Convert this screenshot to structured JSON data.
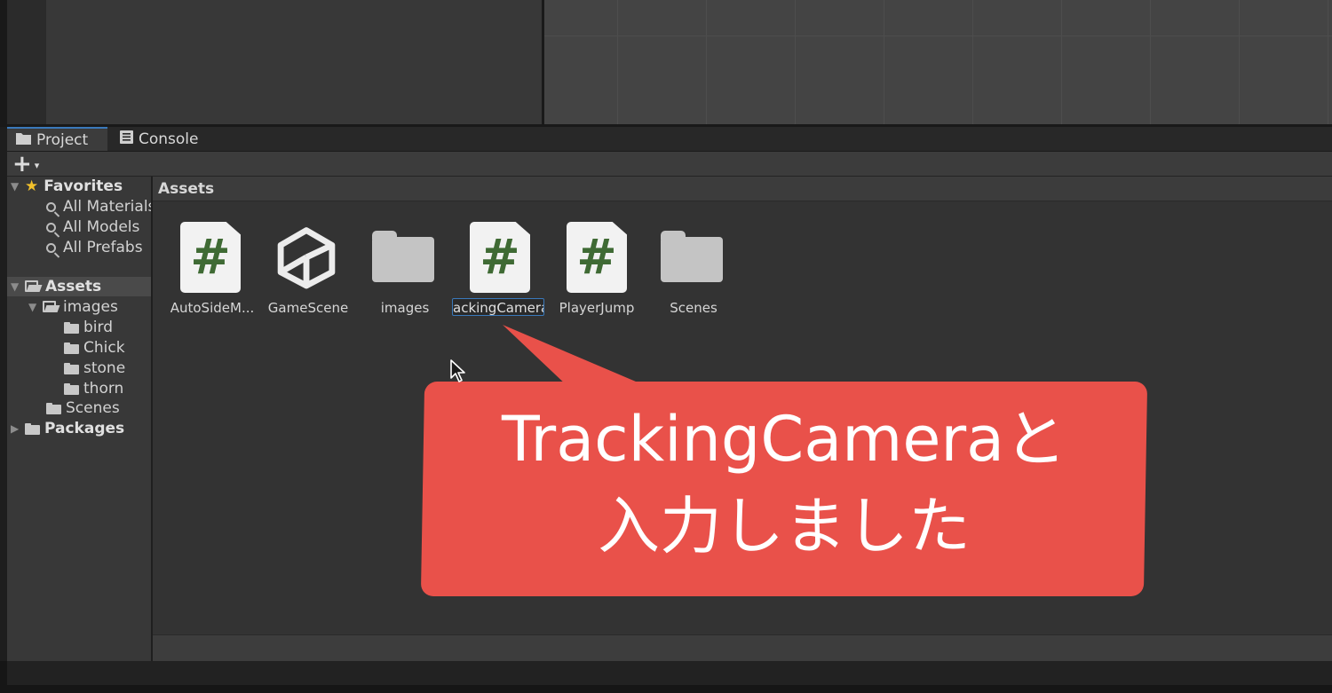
{
  "tabs": [
    {
      "label": "Project",
      "icon": "folder-icon"
    },
    {
      "label": "Console",
      "icon": "console-icon"
    }
  ],
  "toolbar": {
    "add_label": "+",
    "add_caret": "▾"
  },
  "sidebar": {
    "favorites": {
      "label": "Favorites",
      "items": [
        "All Materials",
        "All Models",
        "All Prefabs"
      ]
    },
    "assets": {
      "label": "Assets",
      "images": {
        "label": "images",
        "children": [
          "bird",
          "Chick",
          "stone",
          "thorn"
        ]
      },
      "scenes": "Scenes"
    },
    "packages": "Packages"
  },
  "assets_header": "Assets",
  "assets": [
    {
      "label": "AutoSideM...",
      "type": "script"
    },
    {
      "label": "GameScene",
      "type": "scene"
    },
    {
      "label": "images",
      "type": "folder"
    },
    {
      "label": "ackingCamera",
      "type": "script",
      "editing": true
    },
    {
      "label": "PlayerJump",
      "type": "script"
    },
    {
      "label": "Scenes",
      "type": "folder"
    }
  ],
  "callout": {
    "line1": "TrackingCameraと",
    "line2": "入力しました",
    "color": "#e9514a"
  }
}
